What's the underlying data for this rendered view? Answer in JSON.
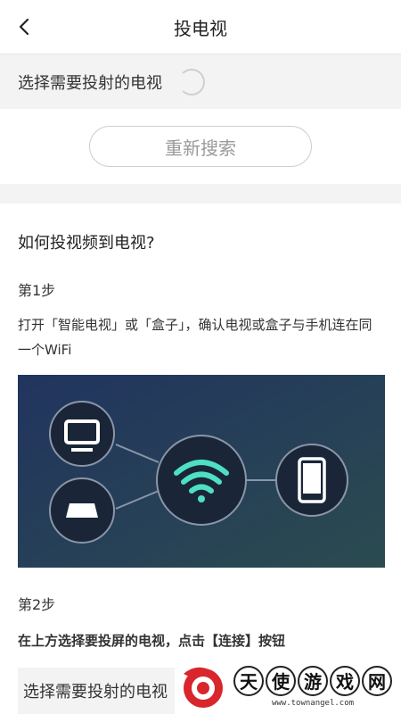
{
  "header": {
    "title": "投电视",
    "back_icon": "chevron-left-icon"
  },
  "select_bar": {
    "label": "选择需要投射的电视",
    "spinner_icon": "loading-spinner-icon"
  },
  "search": {
    "button_label": "重新搜索"
  },
  "help": {
    "title": "如何投视频到电视?",
    "steps": [
      {
        "label": "第1步",
        "desc": "打开「智能电视」或「盒子」，确认电视或盒子与手机连在同一个WiFi"
      },
      {
        "label": "第2步",
        "desc": "在上方选择要投屏的电视，点击【连接】按钮"
      }
    ],
    "illustration_icons": [
      "tv-icon",
      "tv-box-icon",
      "wifi-icon",
      "phone-icon"
    ]
  },
  "preview": {
    "label": "选择需要投射的电视"
  },
  "watermark": {
    "chars": [
      "天",
      "使",
      "游",
      "戏",
      "网"
    ],
    "url": "www.townangel.com"
  },
  "colors": {
    "accent_wifi": "#4ee0c4",
    "logo_red": "#d8262c",
    "illus_bg_start": "#22365f",
    "illus_bg_end": "#2a4a52"
  }
}
